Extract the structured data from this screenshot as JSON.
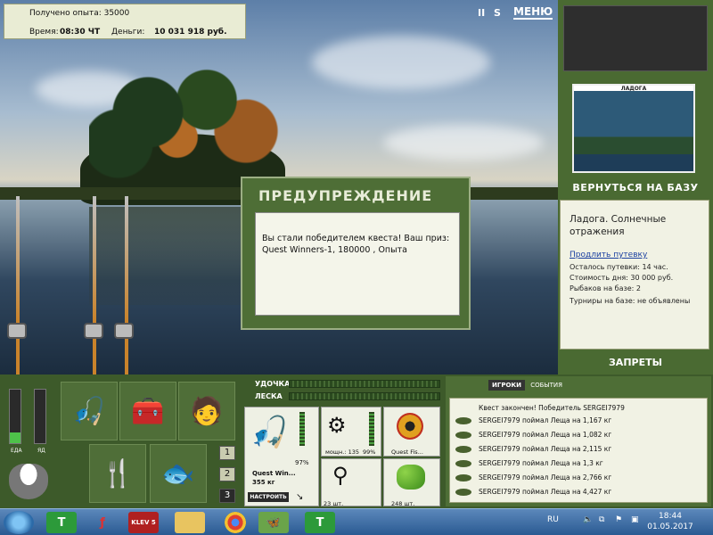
{
  "stats": {
    "experience": "Получено опыта: 35000",
    "time_label": "Время:",
    "time_value": "08:30 ЧТ",
    "money_label": "Деньги:",
    "money_value": "10 031 918 руб."
  },
  "topbar": {
    "pause": "II",
    "sound": "S",
    "menu": "МЕНЮ"
  },
  "location": {
    "thumb_label": "ЛАДОГА",
    "return_base": "ВЕРНУТЬСЯ НА БАЗУ",
    "title": "Ладога. Солнечные отражения",
    "extend_link": "Продлить путевку",
    "lines": [
      "Осталось путевки: 14 час.",
      "Стоимость дня: 30 000 руб.",
      "Рыбаков на базе: 2",
      "Турниры на базе: не объявлены"
    ],
    "bans": "ЗАПРЕТЫ"
  },
  "dialog": {
    "title": "ПРЕДУПРЕЖДЕНИЕ",
    "message": "Вы стали победителем квеста! Ваш приз: Quest Winners-1, 180000 , Опыта"
  },
  "gauges": {
    "food_label": "ЕДА",
    "poison_label": "ЯД",
    "food_level": 0.2,
    "poison_level": 0.0
  },
  "pages": [
    "1",
    "2",
    "3"
  ],
  "tackle": {
    "rod_label": "УДОЧКА",
    "line_label": "ЛЕСКА",
    "rod_name": "Quest Win...",
    "rod_weight": "355 кг",
    "rod_percent": "97%",
    "setup_btn": "НАСТРОИТЬ",
    "reel_power": "мощн.: 135",
    "reel_percent": "99%",
    "line_name": "Quest Fis...",
    "hook_count": "23 шт.",
    "bait_count": "248 шт."
  },
  "log": {
    "tab_players": "ИГРОКИ",
    "tab_events": "СОБЫТИЯ",
    "ended": "Квест закончен! Победитель SERGEI7979",
    "rows": [
      "SERGEI7979 поймал Леща на 1,167 кг",
      "SERGEI7979 поймал Леща на 1,082 кг",
      "SERGEI7979 поймал Леща на 2,115 кг",
      "SERGEI7979 поймал Леща на 1,3 кг",
      "SERGEI7979 поймал Леща на 2,766 кг",
      "SERGEI7979 поймал Леща на 4,427 кг"
    ]
  },
  "taskbar": {
    "app1": "T",
    "app3": "KLEV 5",
    "app6": "T",
    "lang": "RU",
    "time": "18:44",
    "date": "01.05.2017"
  }
}
